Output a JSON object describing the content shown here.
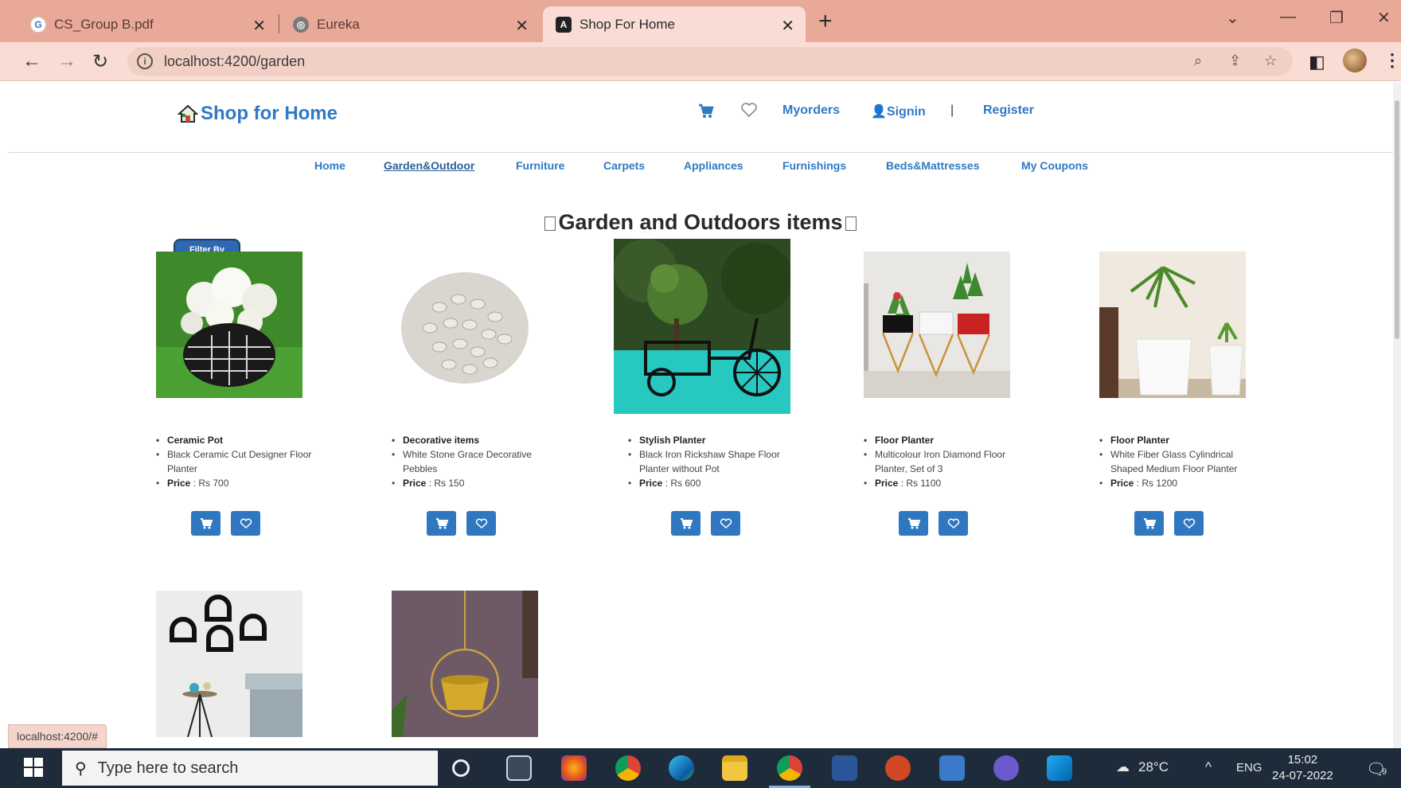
{
  "browser": {
    "tabs": [
      {
        "title": "CS_Group B.pdf",
        "favicon": "g-letter-icon"
      },
      {
        "title": "Eureka",
        "favicon": "globe-icon"
      },
      {
        "title": "Shop For Home",
        "favicon": "angular-icon",
        "active": true
      }
    ],
    "url": "localhost:4200/garden",
    "status_url": "localhost:4200/#"
  },
  "header": {
    "brand": "Shop for Home",
    "myorders": "Myorders",
    "signin": "Signin",
    "separator": "|",
    "register": "Register"
  },
  "categories": [
    {
      "label": "Home"
    },
    {
      "label": "Garden&Outdoor",
      "active": true
    },
    {
      "label": "Furniture"
    },
    {
      "label": "Carpets"
    },
    {
      "label": "Appliances"
    },
    {
      "label": "Furnishings"
    },
    {
      "label": "Beds&Mattresses"
    },
    {
      "label": "My Coupons"
    }
  ],
  "page": {
    "title": "Garden and Outdoors items",
    "filter_label": "Filter By"
  },
  "products": [
    {
      "name": "Ceramic Pot",
      "description": "Black Ceramic Cut Designer Floor Planter",
      "price_label": "Price",
      "price": ": Rs 700"
    },
    {
      "name": "Decorative items",
      "description": "White Stone Grace Decorative Pebbles",
      "price_label": "Price",
      "price": ": Rs 150"
    },
    {
      "name": "Stylish Planter",
      "description": "Black Iron Rickshaw Shape Floor Planter without Pot",
      "price_label": "Price",
      "price": ": Rs 600"
    },
    {
      "name": "Floor Planter",
      "description": "Multicolour Iron Diamond Floor Planter, Set of 3",
      "price_label": "Price",
      "price": ": Rs 1100"
    },
    {
      "name": "Floor Planter",
      "description": "White Fiber Glass Cylindrical Shaped Medium Floor Planter",
      "price_label": "Price",
      "price": ": Rs 1200"
    }
  ],
  "taskbar": {
    "search_placeholder": "Type here to search",
    "weather": "28°C",
    "language": "ENG",
    "time": "15:02",
    "date": "24-07-2022",
    "notification_count": "9"
  },
  "colors": {
    "tabbar": "#e9a999",
    "accent": "#2f7ac4",
    "button": "#2f78c0"
  }
}
